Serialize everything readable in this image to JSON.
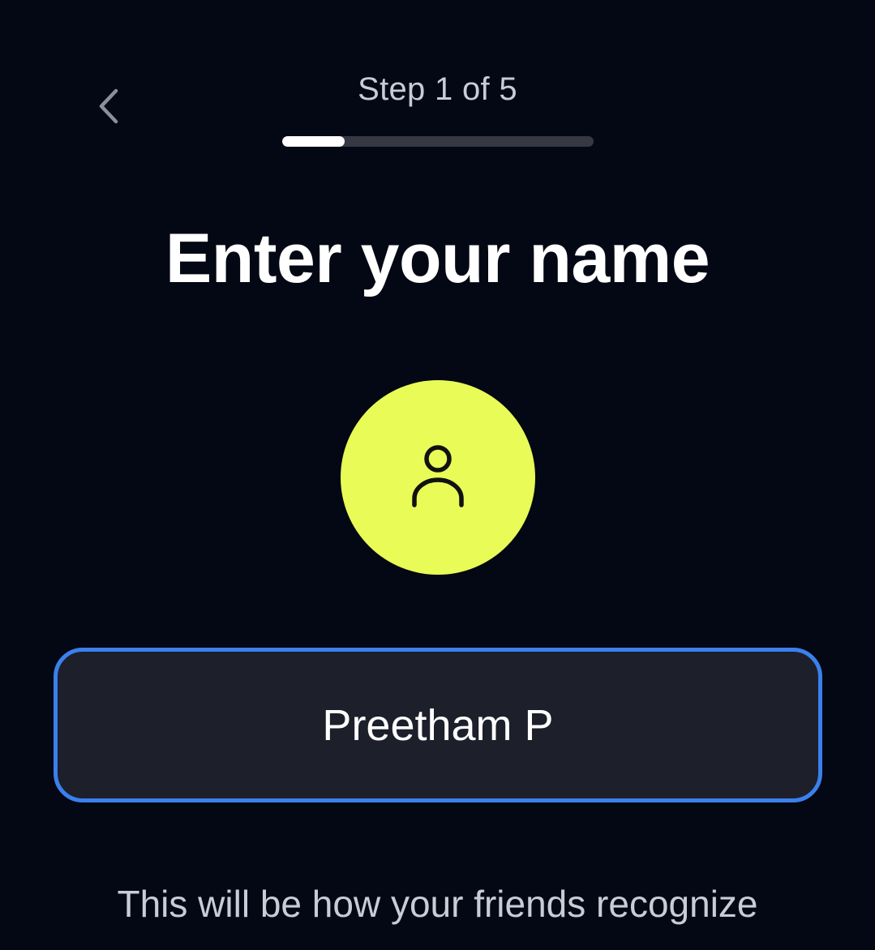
{
  "header": {
    "back_icon": "chevron-left-icon",
    "step_label": "Step 1 of 5",
    "progress": 0.2
  },
  "main": {
    "title": "Enter your name",
    "avatar": {
      "icon": "user-icon",
      "color": "#e9fb56"
    },
    "name_field": {
      "value": "Preetham P",
      "focus_color": "#3b80ec"
    },
    "helper_text": "This will be how your friends recognize"
  },
  "colors": {
    "background": "#030814",
    "field_background": "#1d1f2b",
    "progress_track": "#363944"
  }
}
